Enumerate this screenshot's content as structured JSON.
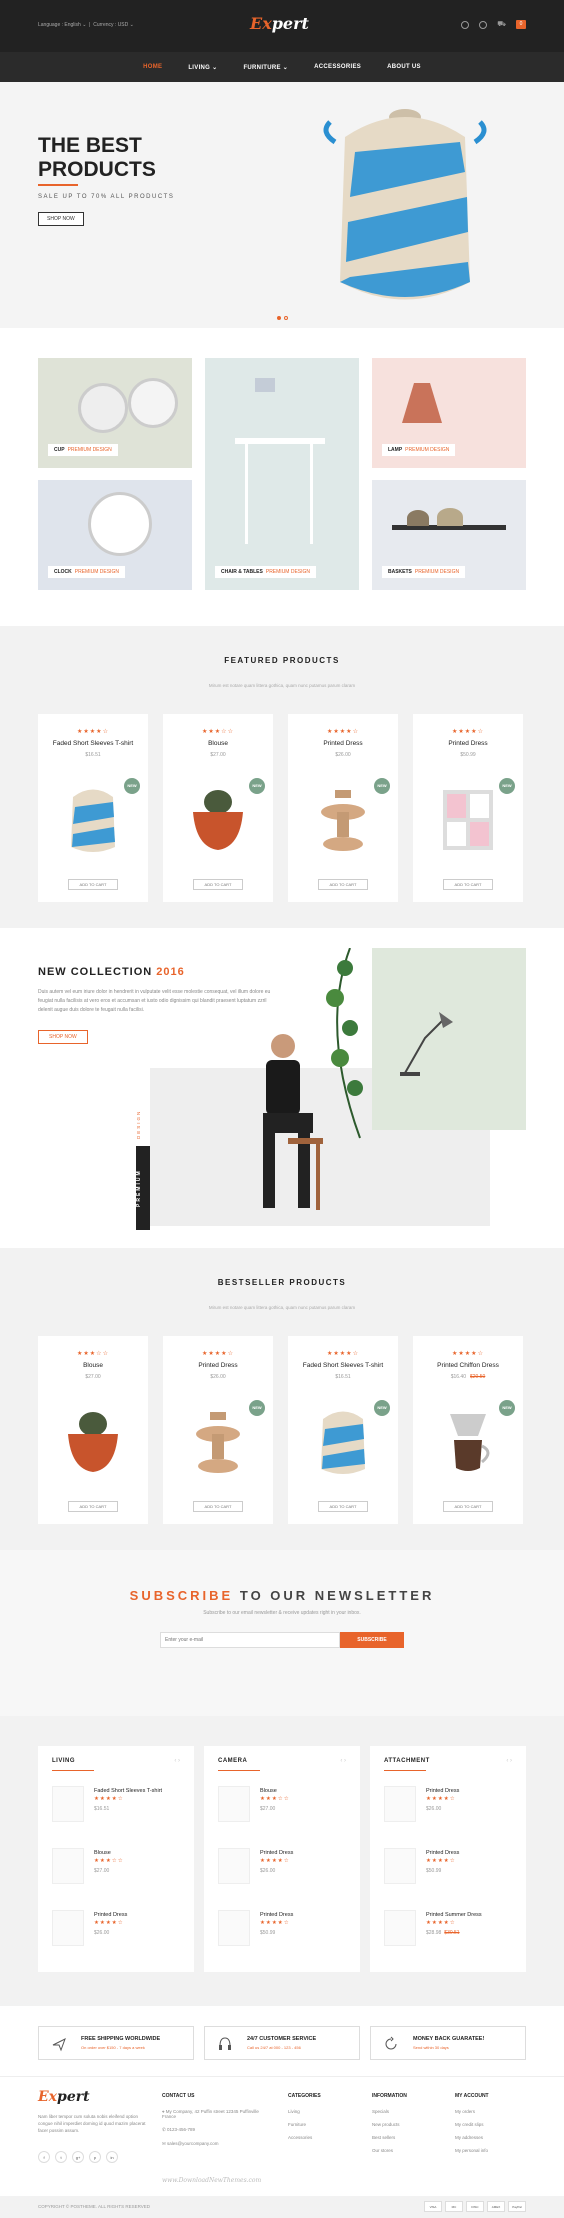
{
  "topbar": {
    "language": "Language : English",
    "currency": "Currency : USD",
    "logo_ex": "Ex",
    "logo_rest": "pert",
    "cart_count": "0"
  },
  "nav": [
    "HOME",
    "LIVING",
    "FURNITURE",
    "ACCESSORIES",
    "ABOUT US"
  ],
  "hero": {
    "title_line1": "THE BEST",
    "title_line2": "PRODUCTS",
    "subtitle": "SALE UP TO 70% ALL PRODUCTS",
    "button": "SHOP NOW"
  },
  "categories": [
    {
      "name": "CUP",
      "tag": "PREMIUM DESIGN"
    },
    {
      "name": "CHAIR & TABLES",
      "tag": "PREMIUM DESIGN"
    },
    {
      "name": "LAMP",
      "tag": "PREMIUM DESIGN"
    },
    {
      "name": "CLOCK",
      "tag": "PREMIUM DESIGN"
    },
    {
      "name": "BASKETS",
      "tag": "PREMIUM DESIGN"
    }
  ],
  "featured": {
    "title": "FEATURED PRODUCTS",
    "subtitle": "Mirum est notare quam littera gothica, quam nunc putamus parum claram",
    "add_label": "ADD TO CART",
    "new_label": "NEW",
    "products": [
      {
        "name": "Faded Short Sleeves T-shirt",
        "price": "$16.51",
        "stars": "★★★★☆"
      },
      {
        "name": "Blouse",
        "price": "$27.00",
        "stars": "★★★☆☆"
      },
      {
        "name": "Printed Dress",
        "price": "$26.00",
        "stars": "★★★★☆"
      },
      {
        "name": "Printed Dress",
        "price": "$50.99",
        "stars": "★★★★☆"
      }
    ]
  },
  "collection": {
    "title": "NEW COLLECTION",
    "year": "2016",
    "text": "Duis autem vel eum iriure dolor in hendrerit in vulputate velit esse molestie consequat, vel illum dolore eu feugiat nulla facilisis at vero eros et accumsan et iusto odio dignissim qui blandit praesent luptatum zzril delenit augue duis dolore te feugait nulla facilisi.",
    "button": "SHOP NOW",
    "vertical_label": "PREMIUM",
    "vertical_design": "DESIGN"
  },
  "bestseller": {
    "title": "BESTSELLER PRODUCTS",
    "subtitle": "Mirum est notare quam littera gothica, quam nunc putamus parum claram",
    "add_label": "ADD TO CART",
    "new_label": "NEW",
    "products": [
      {
        "name": "Blouse",
        "price": "$27.00",
        "old": "",
        "stars": "★★★☆☆"
      },
      {
        "name": "Printed Dress",
        "price": "$26.00",
        "old": "",
        "stars": "★★★★☆"
      },
      {
        "name": "Faded Short Sleeves T-shirt",
        "price": "$16.51",
        "old": "",
        "stars": "★★★★☆"
      },
      {
        "name": "Printed Chiffon Dress",
        "price": "$16.40",
        "old": "$20.50",
        "stars": "★★★★☆"
      }
    ]
  },
  "newsletter": {
    "title_accent": "SUBSCRIBE",
    "title_rest": "TO OUR NEWSLETTER",
    "desc": "Subscribe to our email newsletter & receive updates right in your inbox.",
    "placeholder": "Enter your e-mail",
    "button": "SUBSCRIBE"
  },
  "lists": [
    {
      "title": "LIVING",
      "items": [
        {
          "name": "Faded Short Sleeves T-shirt",
          "price": "$16.51",
          "old": ""
        },
        {
          "name": "Blouse",
          "price": "$27.00",
          "old": ""
        },
        {
          "name": "Printed Dress",
          "price": "$26.00",
          "old": ""
        }
      ]
    },
    {
      "title": "CAMERA",
      "items": [
        {
          "name": "Blouse",
          "price": "$27.00",
          "old": ""
        },
        {
          "name": "Printed Dress",
          "price": "$26.00",
          "old": ""
        },
        {
          "name": "Printed Dress",
          "price": "$50.99",
          "old": ""
        }
      ]
    },
    {
      "title": "ATTACHMENT",
      "items": [
        {
          "name": "Printed Dress",
          "price": "$26.00",
          "old": ""
        },
        {
          "name": "Printed Dress",
          "price": "$50.99",
          "old": ""
        },
        {
          "name": "Printed Summer Dress",
          "price": "$28.98",
          "old": "$30.51"
        }
      ]
    }
  ],
  "services": [
    {
      "title": "FREE SHIPPING WORLDWIDE",
      "sub": "On order over $150 - 7 days a week"
    },
    {
      "title": "24/7 CUSTOMER SERVICE",
      "sub": "Call us 24/7 at 000 - 123 - 456"
    },
    {
      "title": "MONEY BACK GUARATEE!",
      "sub": "Send within 30 days"
    }
  ],
  "footer": {
    "logo_ex": "Ex",
    "logo_rest": "pert",
    "about": "Nam liber tempor cum soluta nobis eleifend option congue nihil imperdiet doming id quod mazim placerat facer possim assum.",
    "contact_title": "CONTACT US",
    "contact": [
      "My Company, 42 Puffin street 12345 Puffinville France",
      "0123-456-789",
      "sales@yourcompany.com"
    ],
    "cols": [
      {
        "title": "CATEGORIES",
        "items": [
          "Living",
          "Furniture",
          "Accessories"
        ]
      },
      {
        "title": "INFORMATION",
        "items": [
          "Specials",
          "New products",
          "Best sellers",
          "Our stores"
        ]
      },
      {
        "title": "MY ACCOUNT",
        "items": [
          "My orders",
          "My credit slips",
          "My addresses",
          "My personal info"
        ]
      }
    ],
    "watermark": "www.DownloadNewThemes.com",
    "social": [
      "f",
      "t",
      "g+",
      "p",
      "in"
    ],
    "copyright": "COPYRIGHT © POSTHEME. ALL RIGHTS RESERVED",
    "payments": [
      "VISA",
      "MC",
      "DISC",
      "AMEX",
      "PayPal"
    ]
  },
  "colors": {
    "accent": "#e8642b",
    "dark": "#222222",
    "badge": "#7aa28a"
  }
}
